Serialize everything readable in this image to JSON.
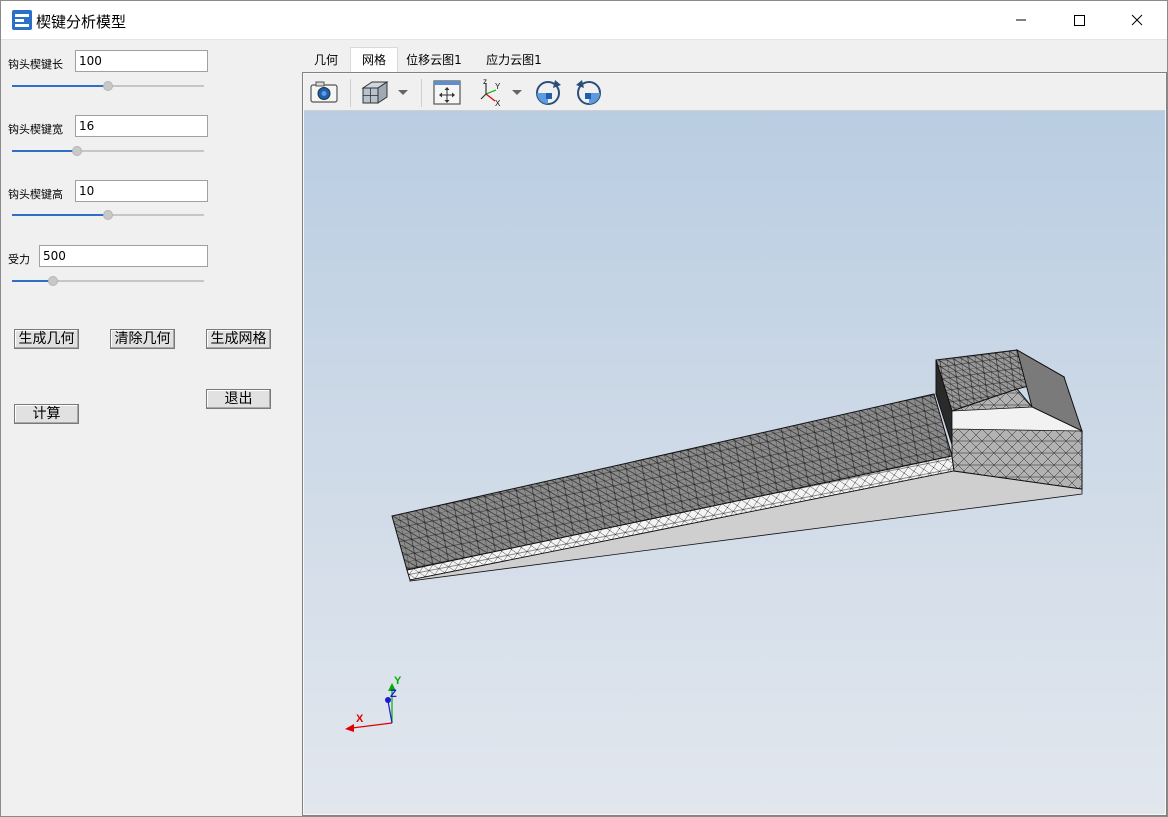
{
  "window": {
    "title": "楔键分析模型"
  },
  "params": {
    "length": {
      "label": "钩头楔键长",
      "value": "100",
      "slider_value": 0.5
    },
    "width": {
      "label": "钩头楔键宽",
      "value": "16",
      "slider_value": 0.33
    },
    "height": {
      "label": "钩头楔键高",
      "value": "10",
      "slider_value": 0.5
    },
    "force": {
      "label": "受力",
      "value": "500",
      "slider_value": 0.2
    }
  },
  "buttons": {
    "gen_geometry": "生成几何",
    "clear_geometry": "清除几何",
    "gen_mesh": "生成网格",
    "compute": "计算",
    "exit": "退出"
  },
  "tabs": [
    "几何",
    "网格",
    "位移云图1",
    "应力云图1"
  ],
  "active_tab": "网格",
  "toolbar": {
    "icons": [
      "camera-icon",
      "view-cube-icon",
      "fit-view-icon",
      "axes-icon",
      "rotate-cw-icon",
      "rotate-ccw-icon"
    ]
  },
  "triad": {
    "x": "X",
    "y": "Y",
    "z": "Z"
  },
  "colors": {
    "accent": "#2f6fc6",
    "mesh_fill": "#8c8c8c",
    "axis_x": "#e00000",
    "axis_y": "#00b000",
    "axis_z": "#1a1ad0"
  }
}
